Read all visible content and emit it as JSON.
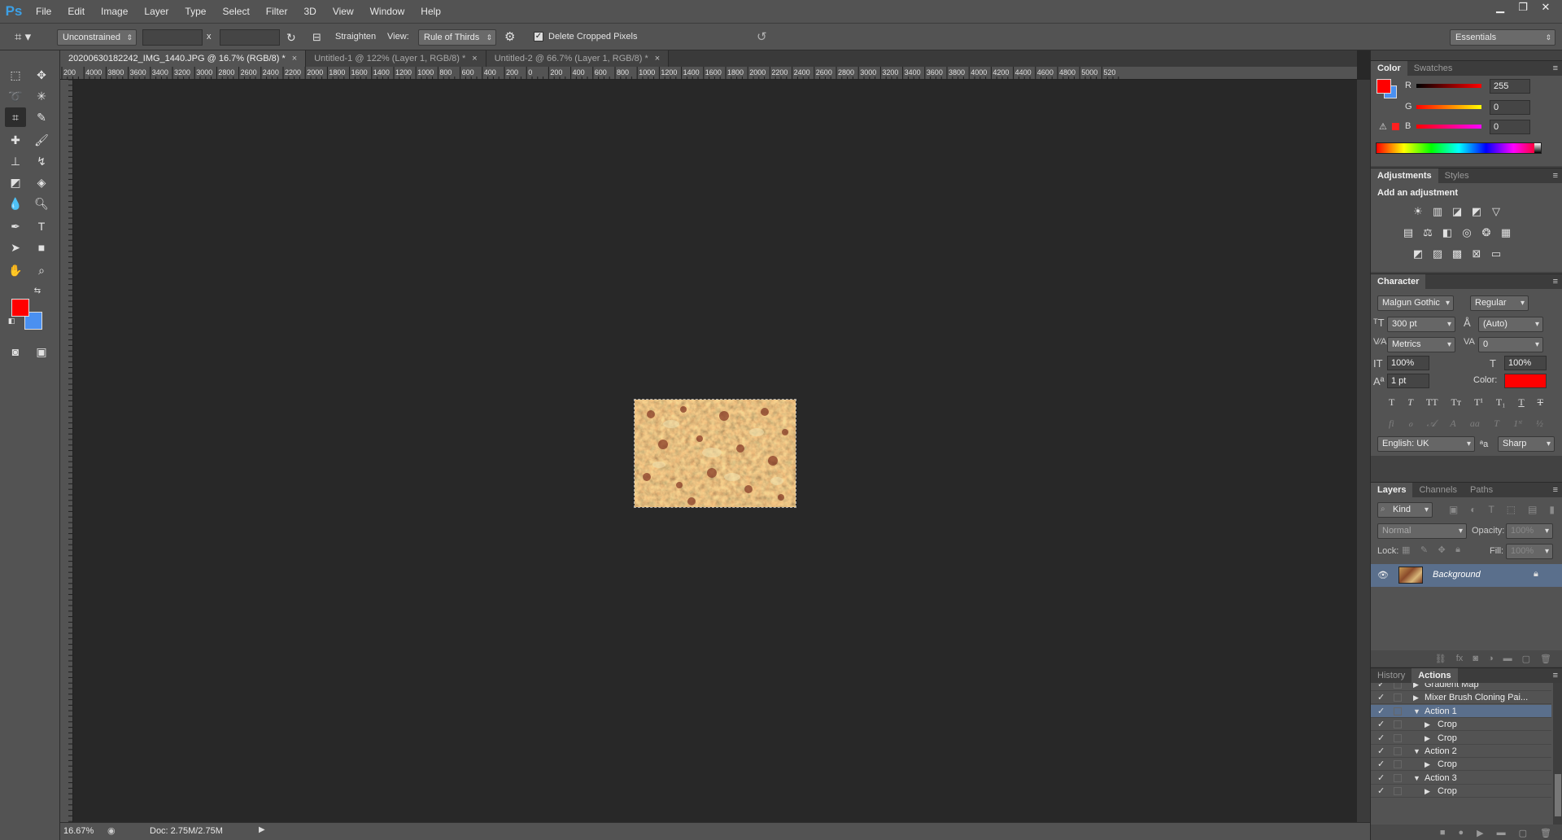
{
  "app": {
    "logo": "Ps",
    "menu": [
      "File",
      "Edit",
      "Image",
      "Layer",
      "Type",
      "Select",
      "Filter",
      "3D",
      "View",
      "Window",
      "Help"
    ],
    "window_controls": [
      "minimize-icon",
      "restore-icon",
      "close-icon"
    ]
  },
  "options_bar": {
    "ratio": "Unconstrained",
    "times_sign": "x",
    "straighten_label": "Straighten",
    "view_label": "View:",
    "view_value": "Rule of Thirds",
    "delete_cropped_label": "Delete Cropped Pixels",
    "delete_cropped_checked": true,
    "workspace": "Essentials"
  },
  "tabs": [
    {
      "label": "20200630182242_IMG_1440.JPG @ 16.7% (RGB/8) *",
      "active": true
    },
    {
      "label": "Untitled-1 @ 122% (Layer 1, RGB/8) *",
      "active": false
    },
    {
      "label": "Untitled-2 @ 66.7% (Layer 1, RGB/8) *",
      "active": false
    }
  ],
  "ruler": {
    "top_labels": [
      "200",
      "4000",
      "3800",
      "3600",
      "3400",
      "3200",
      "3000",
      "2800",
      "2600",
      "2400",
      "2200",
      "2000",
      "1800",
      "1600",
      "1400",
      "1200",
      "1000",
      "800",
      "600",
      "400",
      "200",
      "0",
      "200",
      "400",
      "600",
      "800",
      "1000",
      "1200",
      "1400",
      "1600",
      "1800",
      "2000",
      "2200",
      "2400",
      "2600",
      "2800",
      "3000",
      "3200",
      "3400",
      "3600",
      "3800",
      "4000",
      "4200",
      "4400",
      "4600",
      "4800",
      "5000",
      "520"
    ]
  },
  "colors": {
    "foreground": "#ff0000",
    "background": "#4a90f0",
    "selection": "#5a6f8c"
  },
  "status": {
    "zoom": "16.67%",
    "doc": "Doc: 2.75M/2.75M"
  },
  "color_panel": {
    "tabs": [
      "Color",
      "Swatches"
    ],
    "r_label": "R",
    "g_label": "G",
    "b_label": "B",
    "r": "255",
    "g": "0",
    "b": "0"
  },
  "adjustments_panel": {
    "tabs": [
      "Adjustments",
      "Styles"
    ],
    "heading": "Add an adjustment"
  },
  "character_panel": {
    "tab": "Character",
    "font_family": "Malgun Gothic",
    "font_style": "Regular",
    "size": "300 pt",
    "leading": "(Auto)",
    "kerning": "Metrics",
    "tracking": "0",
    "vscale": "100%",
    "hscale": "100%",
    "baseline": "1 pt",
    "color_label": "Color:",
    "language": "English: UK",
    "aa_label": "ªa",
    "antialias": "Sharp"
  },
  "layers_panel": {
    "tabs": [
      "Layers",
      "Channels",
      "Paths"
    ],
    "kind": "Kind",
    "blend_mode": "Normal",
    "opacity_label": "Opacity:",
    "opacity": "100%",
    "lock_label": "Lock:",
    "fill_label": "Fill:",
    "fill": "100%",
    "layer_name": "Background"
  },
  "actions_panel": {
    "tabs": [
      "History",
      "Actions"
    ],
    "rows": [
      {
        "label": "Gradient Map",
        "indent": 1,
        "expanded": false,
        "selected": false
      },
      {
        "label": "Mixer Brush Cloning Pai...",
        "indent": 1,
        "expanded": false,
        "selected": false
      },
      {
        "label": "Action 1",
        "indent": 1,
        "expanded": true,
        "selected": true
      },
      {
        "label": "Crop",
        "indent": 2,
        "expanded": false,
        "selected": false
      },
      {
        "label": "Crop",
        "indent": 2,
        "expanded": false,
        "selected": false
      },
      {
        "label": "Action 2",
        "indent": 1,
        "expanded": true,
        "selected": false
      },
      {
        "label": "Crop",
        "indent": 2,
        "expanded": false,
        "selected": false
      },
      {
        "label": "Action 3",
        "indent": 1,
        "expanded": true,
        "selected": false
      },
      {
        "label": "Crop",
        "indent": 2,
        "expanded": false,
        "selected": false
      }
    ]
  }
}
